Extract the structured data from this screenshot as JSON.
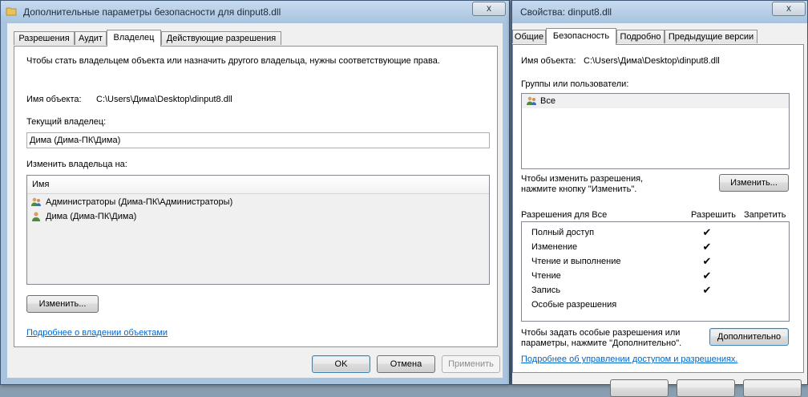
{
  "left_window": {
    "title": "Дополнительные параметры безопасности для dinput8.dll",
    "close_label": "x",
    "tabs": [
      "Разрешения",
      "Аудит",
      "Владелец",
      "Действующие разрешения"
    ],
    "active_tab": "Владелец",
    "info_text": "Чтобы стать владельцем объекта или назначить другого владельца, нужны соответствующие права.",
    "object_name_label": "Имя объекта:",
    "object_name_value": "C:\\Users\\Дима\\Desktop\\dinput8.dll",
    "current_owner_label": "Текущий владелец:",
    "current_owner_value": "Дима (Дима-ПК\\Дима)",
    "change_owner_label": "Изменить владельца на:",
    "list_header": "Имя",
    "list_items": [
      {
        "name": "Администраторы (Дима-ПК\\Администраторы)",
        "icon": "group-icon"
      },
      {
        "name": "Дима (Дима-ПК\\Дима)",
        "icon": "user-icon"
      }
    ],
    "change_button": "Изменить...",
    "link": "Подробнее о владении объектами",
    "ok": "OK",
    "cancel": "Отмена",
    "apply": "Применить"
  },
  "right_window": {
    "title": "Свойства: dinput8.dll",
    "close_label": "x",
    "tabs": [
      "Общие",
      "Безопасность",
      "Подробно",
      "Предыдущие версии"
    ],
    "active_tab": "Безопасность",
    "object_name_label": "Имя объекта:",
    "object_name_value": "C:\\Users\\Дима\\Desktop\\dinput8.dll",
    "groups_label": "Группы или пользователи:",
    "groups": [
      {
        "name": "Все",
        "icon": "group-icon"
      }
    ],
    "change_hint": "Чтобы изменить разрешения,\nнажмите кнопку \"Изменить\".",
    "change_button": "Изменить...",
    "permissions_label": "Разрешения для Все",
    "allow_header": "Разрешить",
    "deny_header": "Запретить",
    "permissions": [
      {
        "name": "Полный доступ",
        "allow": true
      },
      {
        "name": "Изменение",
        "allow": true
      },
      {
        "name": "Чтение и выполнение",
        "allow": true
      },
      {
        "name": "Чтение",
        "allow": true
      },
      {
        "name": "Запись",
        "allow": true
      },
      {
        "name": "Особые разрешения",
        "allow": false
      }
    ],
    "check_mark": "✔",
    "advanced_hint": "Чтобы задать особые разрешения или\nпараметры, нажмите \"Дополнительно\".",
    "advanced_button": "Дополнительно",
    "link": "Подробнее об управлении доступом и разрешениях."
  }
}
